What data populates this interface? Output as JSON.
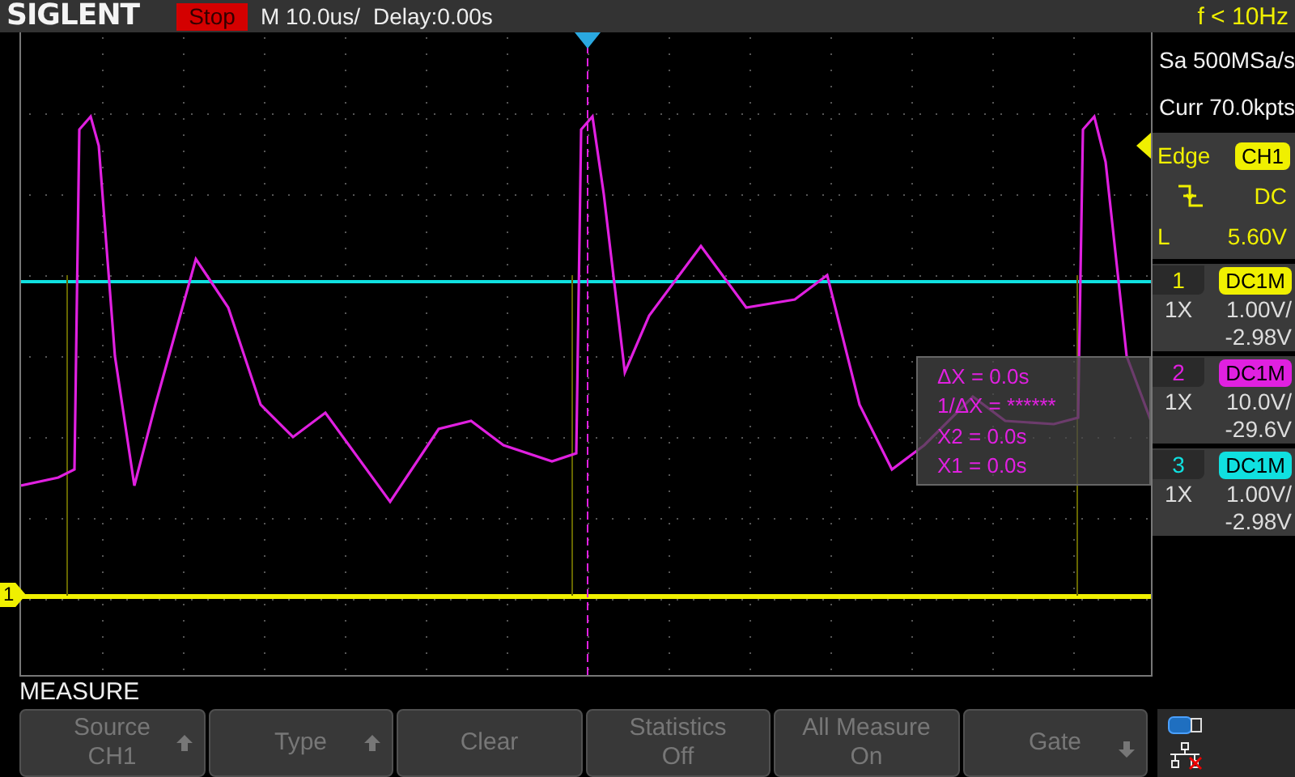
{
  "header": {
    "brand": "SIGLENT",
    "run_state": "Stop",
    "timebase": "M 10.0us/",
    "delay": "Delay:0.00s",
    "frequency": "f < 10Hz"
  },
  "acquisition": {
    "sample_rate": "Sa 500MSa/s",
    "memory": "Curr 70.0kpts"
  },
  "trigger": {
    "type": "Edge",
    "source": "CH1",
    "coupling": "DC",
    "level_label": "L",
    "level_value": "5.60V"
  },
  "channels": [
    {
      "number": "1",
      "coupling": "DC1M",
      "probe": "1X",
      "scale": "1.00V/",
      "offset": "-2.98V",
      "color": "#f0f000"
    },
    {
      "number": "2",
      "coupling": "DC1M",
      "probe": "1X",
      "scale": "10.0V/",
      "offset": "-29.6V",
      "color": "#e020e0"
    },
    {
      "number": "3",
      "coupling": "DC1M",
      "probe": "1X",
      "scale": "1.00V/",
      "offset": "-2.98V",
      "color": "#10e0e0"
    }
  ],
  "ground_marker": "1",
  "cursor_readout": [
    "ΔX = 0.0s",
    "1/ΔX = ******",
    "X2 = 0.0s",
    "X1 = 0.0s"
  ],
  "menu": {
    "title": "MEASURE",
    "buttons": [
      {
        "label": "Source",
        "value": "CH1",
        "kind": "up"
      },
      {
        "label": "Type",
        "kind": "up"
      },
      {
        "label": "Clear",
        "kind": "plain"
      },
      {
        "label": "Statistics",
        "value": "Off",
        "kind": "plain"
      },
      {
        "label": "All Measure",
        "value": "On",
        "kind": "plain"
      },
      {
        "label": "Gate",
        "kind": "down"
      }
    ]
  }
}
